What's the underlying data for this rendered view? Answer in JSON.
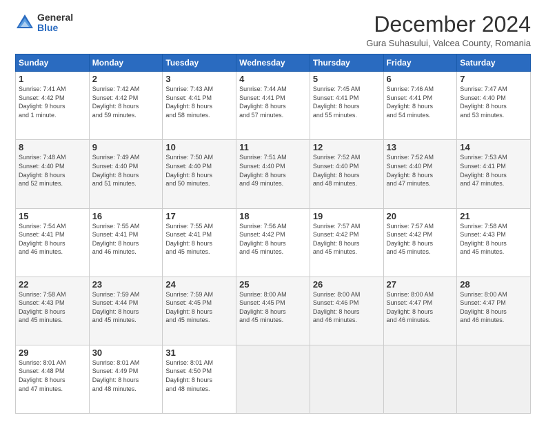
{
  "logo": {
    "general": "General",
    "blue": "Blue"
  },
  "title": "December 2024",
  "subtitle": "Gura Suhasului, Valcea County, Romania",
  "headers": [
    "Sunday",
    "Monday",
    "Tuesday",
    "Wednesday",
    "Thursday",
    "Friday",
    "Saturday"
  ],
  "weeks": [
    [
      {
        "day": "1",
        "info": "Sunrise: 7:41 AM\nSunset: 4:42 PM\nDaylight: 9 hours\nand 1 minute."
      },
      {
        "day": "2",
        "info": "Sunrise: 7:42 AM\nSunset: 4:42 PM\nDaylight: 8 hours\nand 59 minutes."
      },
      {
        "day": "3",
        "info": "Sunrise: 7:43 AM\nSunset: 4:41 PM\nDaylight: 8 hours\nand 58 minutes."
      },
      {
        "day": "4",
        "info": "Sunrise: 7:44 AM\nSunset: 4:41 PM\nDaylight: 8 hours\nand 57 minutes."
      },
      {
        "day": "5",
        "info": "Sunrise: 7:45 AM\nSunset: 4:41 PM\nDaylight: 8 hours\nand 55 minutes."
      },
      {
        "day": "6",
        "info": "Sunrise: 7:46 AM\nSunset: 4:41 PM\nDaylight: 8 hours\nand 54 minutes."
      },
      {
        "day": "7",
        "info": "Sunrise: 7:47 AM\nSunset: 4:40 PM\nDaylight: 8 hours\nand 53 minutes."
      }
    ],
    [
      {
        "day": "8",
        "info": "Sunrise: 7:48 AM\nSunset: 4:40 PM\nDaylight: 8 hours\nand 52 minutes."
      },
      {
        "day": "9",
        "info": "Sunrise: 7:49 AM\nSunset: 4:40 PM\nDaylight: 8 hours\nand 51 minutes."
      },
      {
        "day": "10",
        "info": "Sunrise: 7:50 AM\nSunset: 4:40 PM\nDaylight: 8 hours\nand 50 minutes."
      },
      {
        "day": "11",
        "info": "Sunrise: 7:51 AM\nSunset: 4:40 PM\nDaylight: 8 hours\nand 49 minutes."
      },
      {
        "day": "12",
        "info": "Sunrise: 7:52 AM\nSunset: 4:40 PM\nDaylight: 8 hours\nand 48 minutes."
      },
      {
        "day": "13",
        "info": "Sunrise: 7:52 AM\nSunset: 4:40 PM\nDaylight: 8 hours\nand 47 minutes."
      },
      {
        "day": "14",
        "info": "Sunrise: 7:53 AM\nSunset: 4:41 PM\nDaylight: 8 hours\nand 47 minutes."
      }
    ],
    [
      {
        "day": "15",
        "info": "Sunrise: 7:54 AM\nSunset: 4:41 PM\nDaylight: 8 hours\nand 46 minutes."
      },
      {
        "day": "16",
        "info": "Sunrise: 7:55 AM\nSunset: 4:41 PM\nDaylight: 8 hours\nand 46 minutes."
      },
      {
        "day": "17",
        "info": "Sunrise: 7:55 AM\nSunset: 4:41 PM\nDaylight: 8 hours\nand 45 minutes."
      },
      {
        "day": "18",
        "info": "Sunrise: 7:56 AM\nSunset: 4:42 PM\nDaylight: 8 hours\nand 45 minutes."
      },
      {
        "day": "19",
        "info": "Sunrise: 7:57 AM\nSunset: 4:42 PM\nDaylight: 8 hours\nand 45 minutes."
      },
      {
        "day": "20",
        "info": "Sunrise: 7:57 AM\nSunset: 4:42 PM\nDaylight: 8 hours\nand 45 minutes."
      },
      {
        "day": "21",
        "info": "Sunrise: 7:58 AM\nSunset: 4:43 PM\nDaylight: 8 hours\nand 45 minutes."
      }
    ],
    [
      {
        "day": "22",
        "info": "Sunrise: 7:58 AM\nSunset: 4:43 PM\nDaylight: 8 hours\nand 45 minutes."
      },
      {
        "day": "23",
        "info": "Sunrise: 7:59 AM\nSunset: 4:44 PM\nDaylight: 8 hours\nand 45 minutes."
      },
      {
        "day": "24",
        "info": "Sunrise: 7:59 AM\nSunset: 4:45 PM\nDaylight: 8 hours\nand 45 minutes."
      },
      {
        "day": "25",
        "info": "Sunrise: 8:00 AM\nSunset: 4:45 PM\nDaylight: 8 hours\nand 45 minutes."
      },
      {
        "day": "26",
        "info": "Sunrise: 8:00 AM\nSunset: 4:46 PM\nDaylight: 8 hours\nand 46 minutes."
      },
      {
        "day": "27",
        "info": "Sunrise: 8:00 AM\nSunset: 4:47 PM\nDaylight: 8 hours\nand 46 minutes."
      },
      {
        "day": "28",
        "info": "Sunrise: 8:00 AM\nSunset: 4:47 PM\nDaylight: 8 hours\nand 46 minutes."
      }
    ],
    [
      {
        "day": "29",
        "info": "Sunrise: 8:01 AM\nSunset: 4:48 PM\nDaylight: 8 hours\nand 47 minutes."
      },
      {
        "day": "30",
        "info": "Sunrise: 8:01 AM\nSunset: 4:49 PM\nDaylight: 8 hours\nand 48 minutes."
      },
      {
        "day": "31",
        "info": "Sunrise: 8:01 AM\nSunset: 4:50 PM\nDaylight: 8 hours\nand 48 minutes."
      },
      {
        "day": "",
        "info": ""
      },
      {
        "day": "",
        "info": ""
      },
      {
        "day": "",
        "info": ""
      },
      {
        "day": "",
        "info": ""
      }
    ]
  ]
}
